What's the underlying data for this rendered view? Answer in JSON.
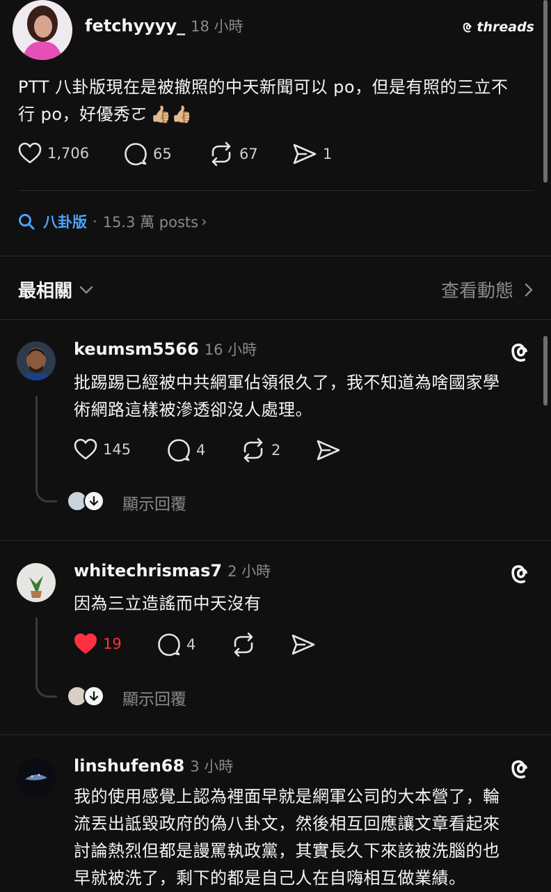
{
  "post": {
    "username": "fetchyyyy_",
    "time": "18 小時",
    "brand": "threads",
    "text_line1": "PTT 八卦版現在是被撤照的中天新聞可以 po，但是有照的三立不",
    "text_line2": "行 po，好優秀ㄛ",
    "emoji": "👍🏼👍🏼",
    "likes": "1,706",
    "comments": "65",
    "reposts": "67",
    "shares": "1"
  },
  "topic": {
    "tag": "八卦版",
    "sep": "·",
    "posts": "15.3 萬 posts"
  },
  "sort": {
    "label": "最相關",
    "activity": "查看動態"
  },
  "replies": [
    {
      "username": "keumsm5566",
      "time": "16 小時",
      "line1": "批踢踢已經被中共網軍佔領很久了，我不知道為啥國家學",
      "line2": "術網路這樣被滲透卻沒人處理。",
      "likes": "145",
      "comments": "4",
      "reposts": "2",
      "show_replies": "顯示回覆"
    },
    {
      "username": "whitechrismas7",
      "time": "2 小時",
      "line1": "因為三立造謠而中天沒有",
      "likes": "19",
      "comments": "4",
      "show_replies": "顯示回覆"
    },
    {
      "username": "linshufen68",
      "time": "3 小時",
      "line1": "我的使用感覺上認為裡面早就是網軍公司的大本營了，輪",
      "line2": "流丟出詆毀政府的偽八卦文，然後相互回應讓文章看起來",
      "line3": "討論熱烈但都是謾罵執政黨，其實長久下來該被洗腦的也",
      "line4": "早就被洗了，剩下的都是自己人在自嗨相互做業績。"
    }
  ],
  "colors": {
    "background": "#101010",
    "accent_blue": "#4aa3ff",
    "liked_red": "#ff3040",
    "muted": "#8a8a8a"
  }
}
